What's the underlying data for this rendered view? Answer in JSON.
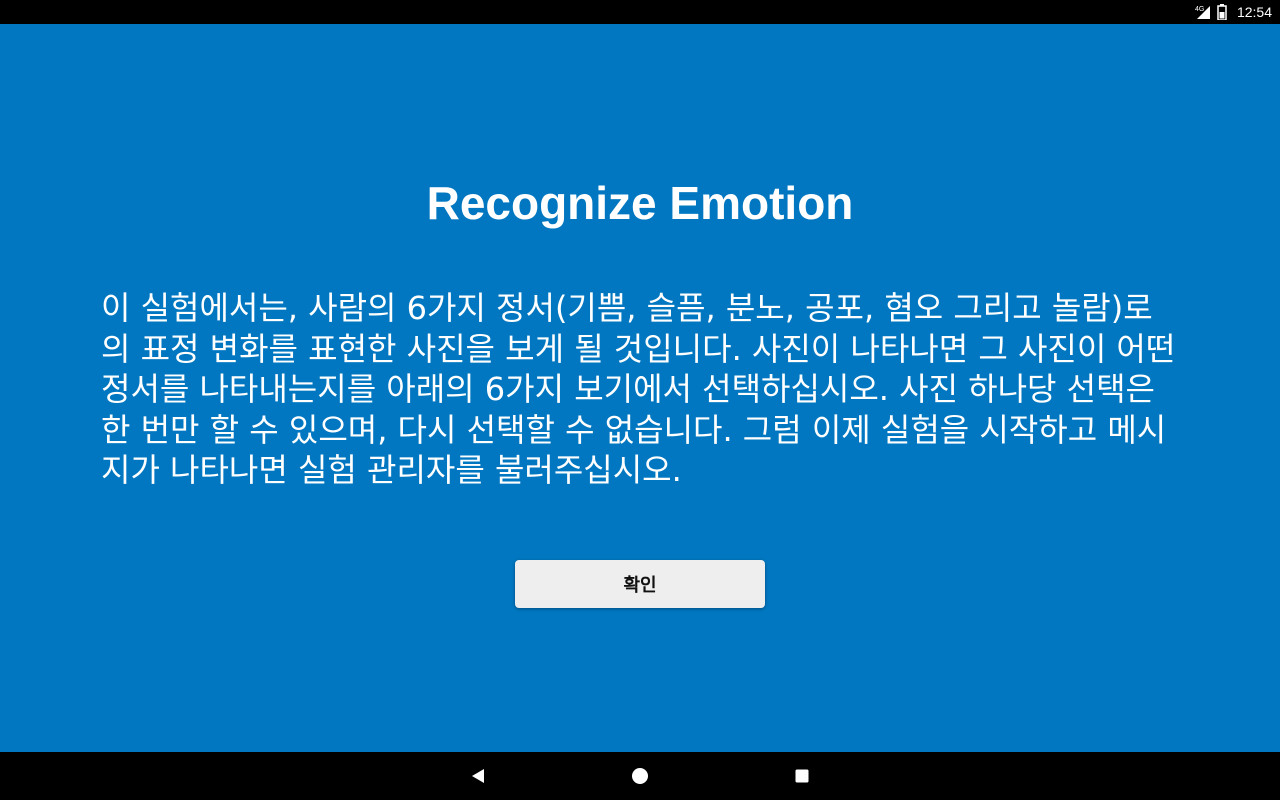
{
  "status_bar": {
    "network_type": "4G",
    "time": "12:54",
    "icons": [
      "signal-icon",
      "battery-icon"
    ]
  },
  "main": {
    "title": "Recognize Emotion",
    "instructions": "이 실험에서는, 사람의 6가지 정서(기쁨, 슬픔, 분노, 공포, 혐오 그리고 놀람)로의 표정 변화를 표현한 사진을 보게 될 것입니다. 사진이 나타나면 그 사진이 어떤 정서를 나타내는지를 아래의 6가지 보기에서 선택하십시오. 사진 하나당 선택은 한 번만 할 수 있으며, 다시 선택할 수 없습니다. 그럼 이제 실험을 시작하고 메시지가 나타나면 실험 관리자를 불러주십시오.",
    "confirm_button_label": "확인",
    "background_color": "#0177c1"
  },
  "nav_bar": {
    "icons": [
      "back-icon",
      "home-icon",
      "recents-icon"
    ]
  }
}
